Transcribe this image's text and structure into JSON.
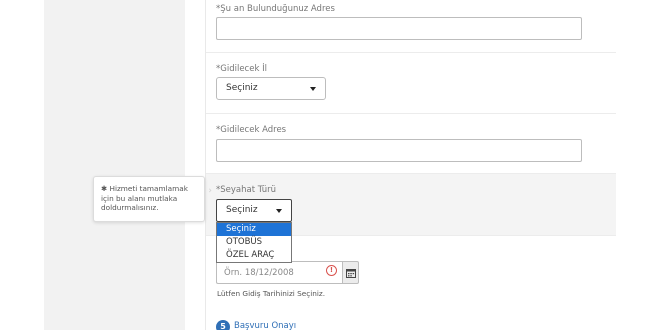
{
  "form": {
    "current_address": {
      "label": "*Şu an Bulunduğunuz Adres",
      "value": ""
    },
    "destination_city": {
      "label": "*Gidilecek İl",
      "selected": "Seçiniz"
    },
    "destination_address": {
      "label": "*Gidilecek Adres",
      "value": ""
    },
    "travel_type": {
      "label": "*Seyahat Türü",
      "selected": "Seçiniz",
      "options": [
        "Seçiniz",
        "OTOBÜS",
        "ÖZEL ARAÇ"
      ]
    },
    "travel_date": {
      "placeholder": "Örn. 18/12/2008",
      "error_icon": "!",
      "hint": "Lütfen Gidiş Tarihinizi Seçiniz."
    }
  },
  "tooltip": {
    "star": "✱",
    "text": "Hizmeti tamamlamak için bu alanı mutlaka doldurmalısınız."
  },
  "next_step": {
    "number": "5",
    "label": "Başvuru Onayı"
  },
  "colors": {
    "accent": "#2f6fb6",
    "selected_option": "#1e73d6",
    "error": "#d9534f"
  },
  "icons": {
    "calendar": "calendar-icon",
    "caret": "caret-down-icon",
    "error": "error-icon"
  }
}
